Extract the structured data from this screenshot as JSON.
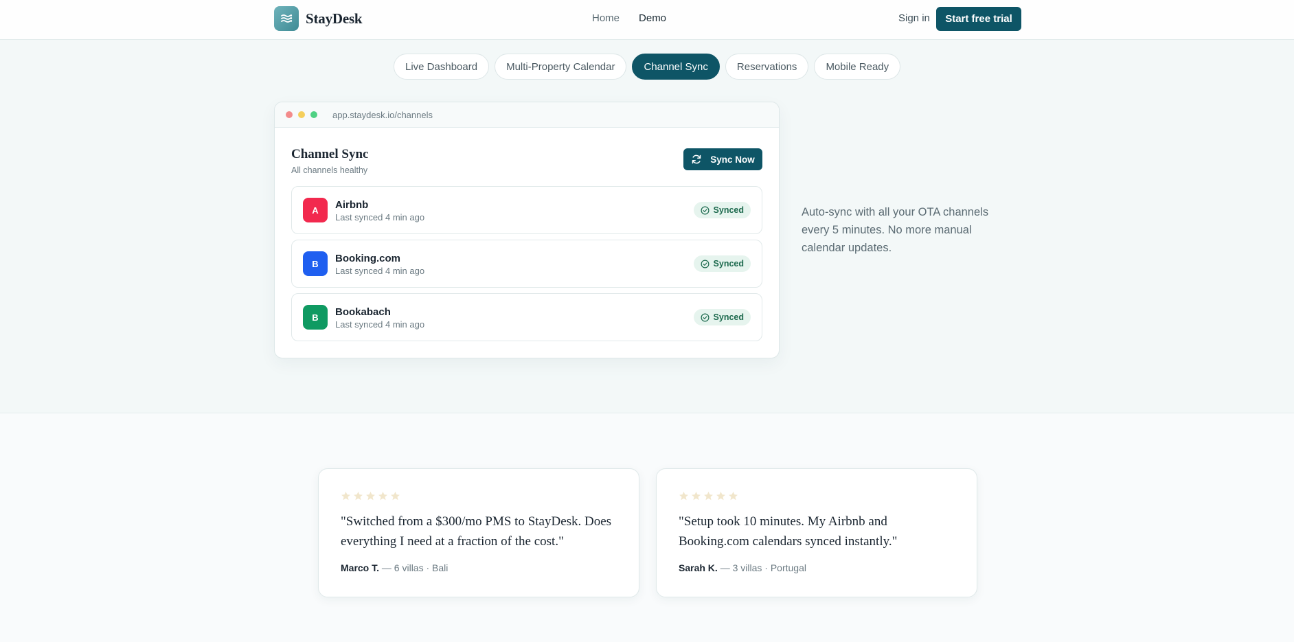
{
  "header": {
    "brand": "StayDesk",
    "nav": [
      {
        "label": "Home"
      },
      {
        "label": "Demo"
      }
    ],
    "signin": "Sign in",
    "cta": "Start free trial"
  },
  "tabs": [
    {
      "label": "Live Dashboard"
    },
    {
      "label": "Multi-Property Calendar"
    },
    {
      "label": "Channel Sync"
    },
    {
      "label": "Reservations"
    },
    {
      "label": "Mobile Ready"
    }
  ],
  "active_tab": "Channel Sync",
  "window": {
    "url": "app.staydesk.io/channels",
    "title": "Channel Sync",
    "subtitle": "All channels healthy",
    "sync_button": "Sync Now",
    "channels": [
      {
        "initial": "A",
        "name": "Airbnb",
        "last_synced": "Last synced 4 min ago",
        "status": "Synced",
        "color": "#f2294e"
      },
      {
        "initial": "B",
        "name": "Booking.com",
        "last_synced": "Last synced 4 min ago",
        "status": "Synced",
        "color": "#1f5ff0"
      },
      {
        "initial": "B",
        "name": "Bookabach",
        "last_synced": "Last synced 4 min ago",
        "status": "Synced",
        "color": "#0f9a62"
      }
    ]
  },
  "side_copy": "Auto-sync with all your OTA channels every 5 minutes. No more manual calendar updates.",
  "reviews": [
    {
      "rating": 5,
      "quote": "\"Switched from a $300/mo PMS to StayDesk. Does everything I need at a fraction of the cost.\"",
      "name": "Marco T.",
      "details": " — 6 villas · Bali"
    },
    {
      "rating": 5,
      "quote": "\"Setup took 10 minutes. My Airbnb and Booking.com calendars synced instantly.\"",
      "name": "Sarah K.",
      "details": " — 3 villas · Portugal"
    }
  ],
  "colors": {
    "primary": "#0e5566",
    "background": "#f3f8f8",
    "synced_badge": "#e6f4ee",
    "star": "#f1e6cc"
  },
  "icons": [
    "menu-waves-icon",
    "refresh-icon",
    "check-circle-icon",
    "star-icon"
  ]
}
